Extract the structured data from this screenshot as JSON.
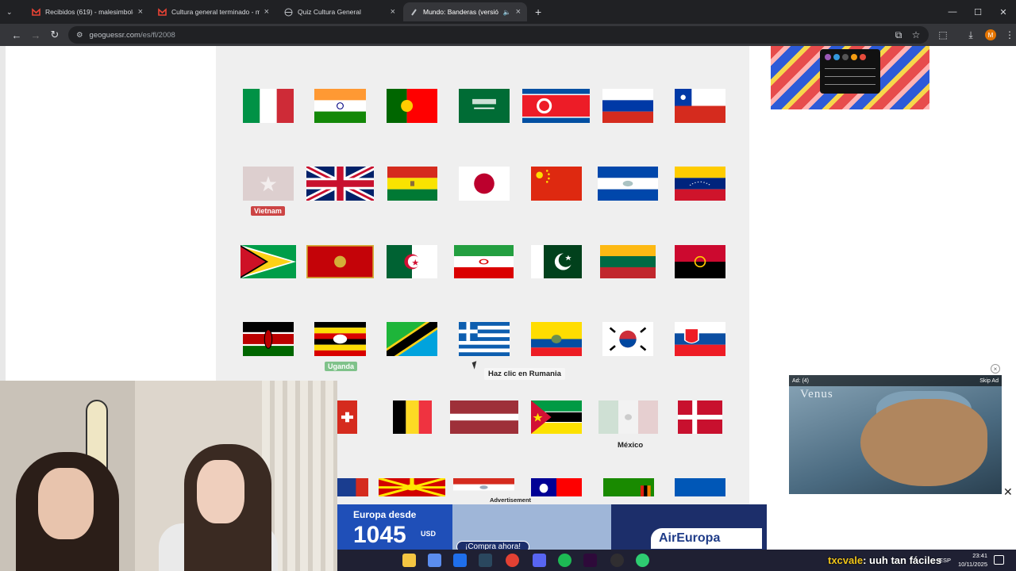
{
  "browser": {
    "tabs": [
      {
        "title": "Recibidos (619) - malesimbol@",
        "icon": "gmail-icon"
      },
      {
        "title": "Cultura general terminado - m",
        "icon": "gmail-icon"
      },
      {
        "title": "Quiz Cultura General",
        "icon": "globe-icon"
      },
      {
        "title": "Mundo: Banderas (versión c",
        "icon": "geoguessr-icon"
      }
    ],
    "url_host": "geoguessr.com",
    "url_path": "/es/fl/2008",
    "profile_initial": "M"
  },
  "quiz": {
    "tooltip": "Haz clic en Rumania",
    "labels": {
      "vietnam": "Vietnam",
      "uganda": "Uganda",
      "mexico": "México"
    }
  },
  "video_ad": {
    "status": "Ad: (4)",
    "skip": "Skip Ad",
    "brand": "Venus"
  },
  "banner_ad": {
    "label": "Advertisement",
    "line1": "Europa desde",
    "price": "1045",
    "currency": "USD",
    "cta": "¡Compra ahora!",
    "logo": "AirEuropa"
  },
  "stream": {
    "chat_user": "txcvale",
    "chat_message": ": uuh tan fáciles"
  },
  "system": {
    "language": "ESP",
    "time": "23:41",
    "date": "10/11/2025"
  },
  "colors": {
    "tab_active": "#35363a",
    "tabstrip": "#202124",
    "panel": "#efefef",
    "correct": "#7fc28a",
    "wrong": "#cc4444"
  }
}
